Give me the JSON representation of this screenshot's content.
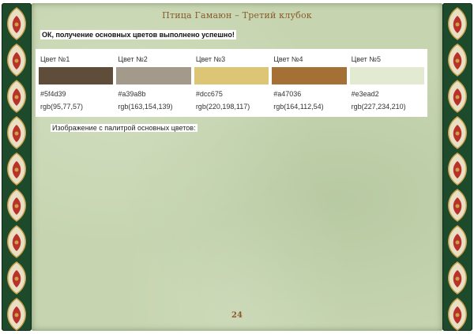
{
  "book": {
    "title": "Птица Гамаюн – Третий клубок",
    "page_number": "24"
  },
  "status": {
    "message": "ОК, получение основных цветов выполнено успешно!"
  },
  "palette": {
    "colors": [
      {
        "label": "Цвет №1",
        "hex": "#5f4d39",
        "rgb": "rgb(95,77,57)"
      },
      {
        "label": "Цвет №2",
        "hex": "#a39a8b",
        "rgb": "rgb(163,154,139)"
      },
      {
        "label": "Цвет №3",
        "hex": "#dcc675",
        "rgb": "rgb(220,198,117)"
      },
      {
        "label": "Цвет №4",
        "hex": "#a47036",
        "rgb": "rgb(164,112,54)"
      },
      {
        "label": "Цвет №5",
        "hex": "#e3ead2",
        "rgb": "rgb(227,234,210)"
      }
    ]
  },
  "image_section": {
    "caption": "Изображение с палитрой основных цветов:"
  },
  "theme": {
    "page_background": "#c6d5b0",
    "border_green": "#1e4a2c",
    "ornament_red": "#b8322a",
    "ornament_gold": "#c9a24a",
    "title_color": "#8a5a2a"
  },
  "icons": {
    "border_ornament": "folk-ornament-icon"
  }
}
